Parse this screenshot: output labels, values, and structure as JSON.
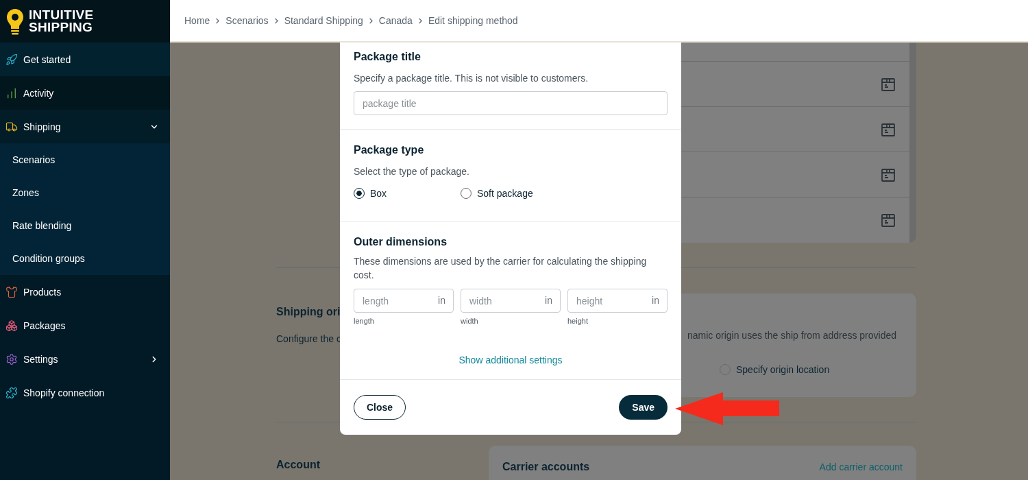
{
  "sidebar": {
    "logo_lines": [
      "INTUITIVE",
      "SHIPPING"
    ],
    "items": [
      {
        "label": "Get started"
      },
      {
        "label": "Activity"
      },
      {
        "label": "Shipping",
        "expanded": true,
        "children": [
          {
            "label": "Scenarios"
          },
          {
            "label": "Zones"
          },
          {
            "label": "Rate blending"
          },
          {
            "label": "Condition groups"
          }
        ]
      },
      {
        "label": "Products"
      },
      {
        "label": "Packages"
      },
      {
        "label": "Settings",
        "expanded": false
      },
      {
        "label": "Shopify connection"
      }
    ]
  },
  "breadcrumb": [
    "Home",
    "Scenarios",
    "Standard Shipping",
    "Canada",
    "Edit shipping method"
  ],
  "background": {
    "origin": {
      "heading": "Shipping ori",
      "description": "Configure the c",
      "card_text": "namic origin uses the ship from address provided",
      "option": {
        "label": "Specify origin location",
        "selected": false
      }
    },
    "account": {
      "heading": "Account",
      "card_title": "Carrier accounts",
      "link": "Add carrier account"
    }
  },
  "modal": {
    "title_section": {
      "heading": "Package title",
      "description": "Specify a package title. This is not visible to customers.",
      "placeholder": "package title"
    },
    "type_section": {
      "heading": "Package type",
      "description": "Select the type of package.",
      "options": [
        {
          "label": "Box",
          "selected": true
        },
        {
          "label": "Soft package",
          "selected": false
        }
      ]
    },
    "dimensions_section": {
      "heading": "Outer dimensions",
      "description": "These dimensions are used by the carrier for calculating the shipping cost.",
      "fields": [
        {
          "placeholder": "length",
          "unit": "in",
          "label": "length"
        },
        {
          "placeholder": "width",
          "unit": "in",
          "label": "width"
        },
        {
          "placeholder": "height",
          "unit": "in",
          "label": "height"
        }
      ],
      "link": "Show additional settings"
    },
    "buttons": {
      "close": "Close",
      "save": "Save"
    }
  }
}
